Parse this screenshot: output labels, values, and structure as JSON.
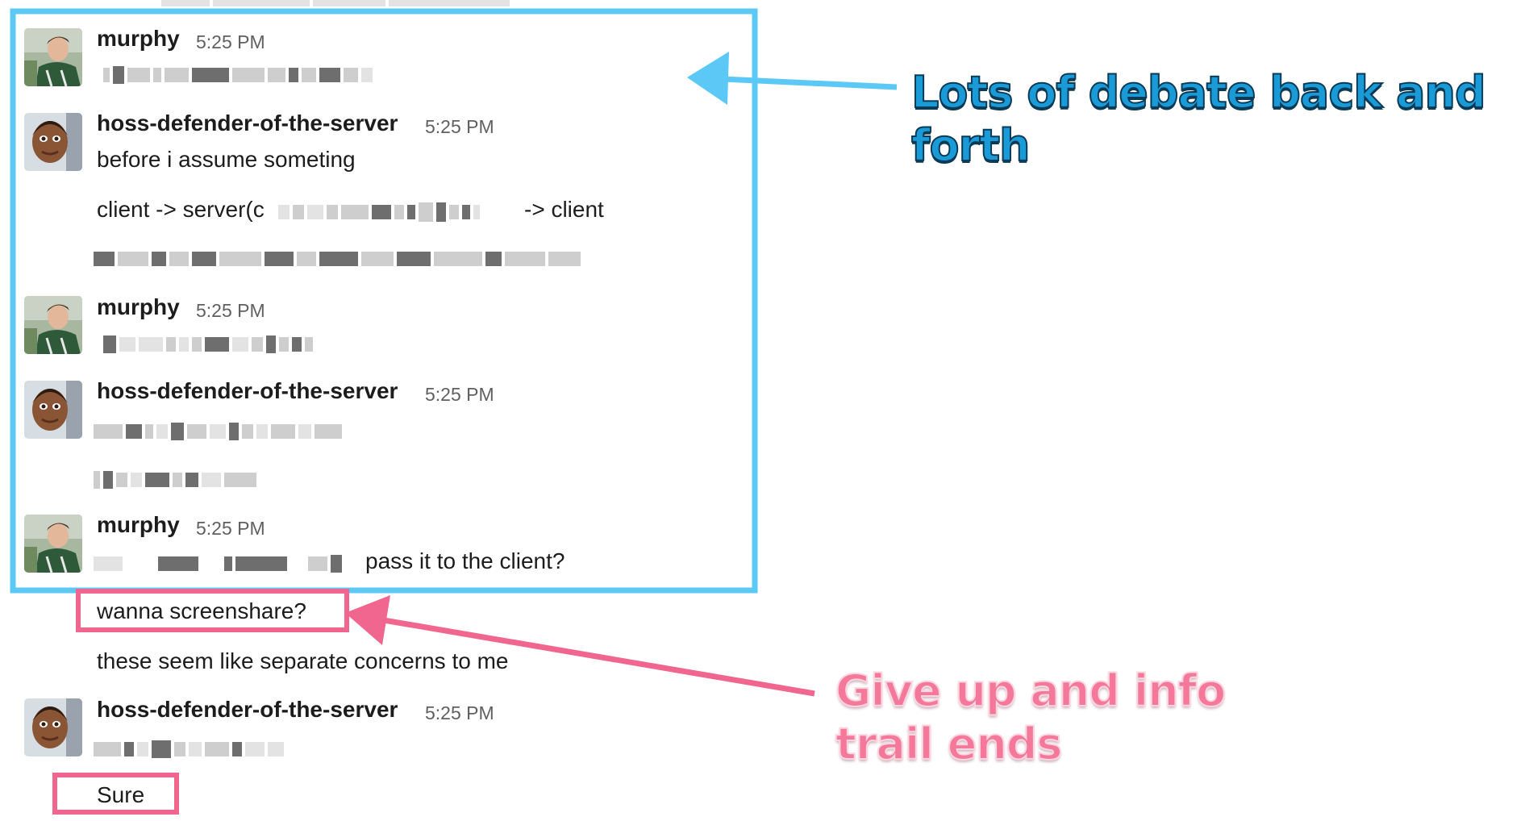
{
  "colors": {
    "highlight_blue": "#5bc8f5",
    "highlight_pink": "#f0668f",
    "callout_blue_text": "#1a9ad6",
    "callout_pink_text": "#f4789a"
  },
  "messages": {
    "m1": {
      "author": "murphy",
      "time": "5:25 PM"
    },
    "m2": {
      "author": "hoss-defender-of-the-server",
      "time": "5:25 PM",
      "line1": "before i assume someting",
      "line2_prefix": "client -> server(c",
      "line2_suffix": "-> client"
    },
    "m3": {
      "author": "murphy",
      "time": "5:25 PM"
    },
    "m4": {
      "author": "hoss-defender-of-the-server",
      "time": "5:25 PM"
    },
    "m5": {
      "author": "murphy",
      "time": "5:25 PM",
      "line1_tail": "pass it to the client?",
      "line2": "wanna screenshare?",
      "line3": "these seem like separate concerns to me"
    },
    "m6": {
      "author": "hoss-defender-of-the-server",
      "time": "5:25 PM",
      "line2": "Sure"
    }
  },
  "annotations": {
    "blue_callout": "Lots of debate back and forth",
    "pink_callout": "Give up and info trail ends"
  },
  "icons": [
    "avatar-murphy",
    "avatar-hoss",
    "arrow-icon"
  ]
}
